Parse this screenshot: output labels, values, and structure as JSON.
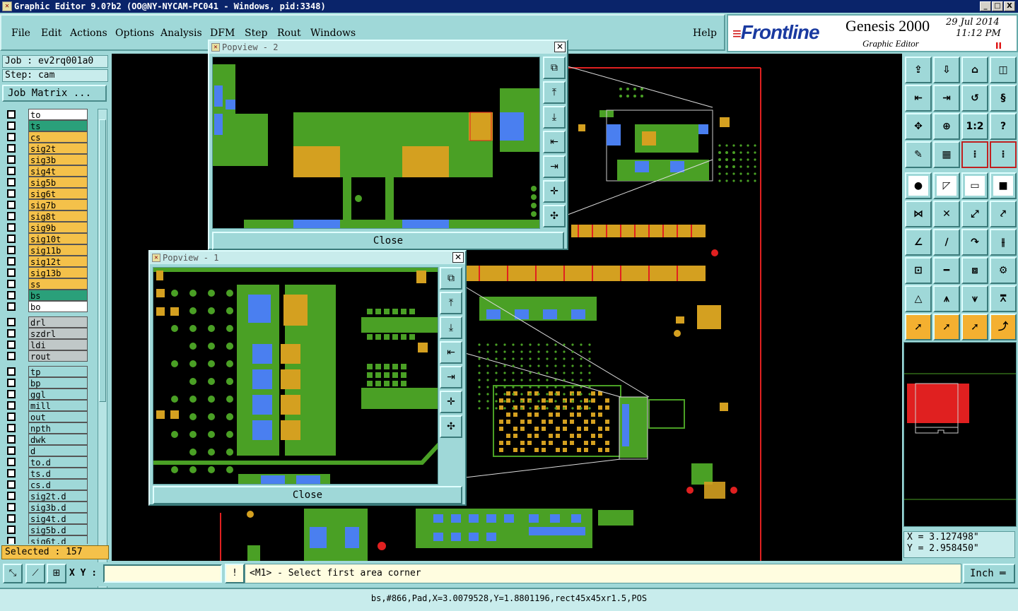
{
  "window": {
    "title": "Graphic Editor 9.0?b2 (OO@NY-NYCAM-PC041 - Windows, pid:3348)",
    "min": "_",
    "max": "□",
    "close": "X"
  },
  "menu": {
    "file": "File",
    "edit": "Edit",
    "actions": "Actions",
    "options": "Options",
    "analysis": "Analysis",
    "dfm": "DFM",
    "step": "Step",
    "rout": "Rout",
    "windows": "Windows",
    "help": "Help"
  },
  "brand": {
    "logo": "Frontline",
    "product": "Genesis 2000",
    "subtitle": "Graphic Editor",
    "date": "29 Jul 2014",
    "time": "11:12 PM",
    "pause": "II"
  },
  "job": {
    "job_line": "Job : ev2rq001a0",
    "step_line": "Step: cam",
    "job_matrix": "Job Matrix ..."
  },
  "layers": {
    "board": [
      {
        "name": "to",
        "color": "#ffffff"
      },
      {
        "name": "ts",
        "color": "#2aa07a"
      },
      {
        "name": "cs",
        "color": "#f4c14a"
      },
      {
        "name": "sig2t",
        "color": "#f4c14a"
      },
      {
        "name": "sig3b",
        "color": "#f4c14a"
      },
      {
        "name": "sig4t",
        "color": "#f4c14a"
      },
      {
        "name": "sig5b",
        "color": "#f4c14a"
      },
      {
        "name": "sig6t",
        "color": "#f4c14a"
      },
      {
        "name": "sig7b",
        "color": "#f4c14a"
      },
      {
        "name": "sig8t",
        "color": "#f4c14a"
      },
      {
        "name": "sig9b",
        "color": "#f4c14a"
      },
      {
        "name": "sig10t",
        "color": "#f4c14a"
      },
      {
        "name": "sig11b",
        "color": "#f4c14a"
      },
      {
        "name": "sig12t",
        "color": "#f4c14a"
      },
      {
        "name": "sig13b",
        "color": "#f4c14a"
      },
      {
        "name": "ss",
        "color": "#f4c14a"
      },
      {
        "name": "bs",
        "color": "#2aa07a"
      },
      {
        "name": "bo",
        "color": "#ffffff"
      }
    ],
    "drill": [
      {
        "name": "drl",
        "color": "#c0c8c8"
      },
      {
        "name": "szdrl",
        "color": "#c0c8c8"
      },
      {
        "name": "ldi",
        "color": "#c0c8c8"
      },
      {
        "name": "rout",
        "color": "#c0c8c8"
      }
    ],
    "misc": [
      {
        "name": "tp",
        "color": "#9fd8d8"
      },
      {
        "name": "bp",
        "color": "#9fd8d8"
      },
      {
        "name": "ggl",
        "color": "#9fd8d8"
      },
      {
        "name": "mill",
        "color": "#9fd8d8"
      },
      {
        "name": "out",
        "color": "#9fd8d8"
      },
      {
        "name": "npth",
        "color": "#9fd8d8"
      },
      {
        "name": "dwk",
        "color": "#9fd8d8"
      },
      {
        "name": "d",
        "color": "#9fd8d8"
      },
      {
        "name": "to.d",
        "color": "#9fd8d8"
      },
      {
        "name": "ts.d",
        "color": "#9fd8d8"
      },
      {
        "name": "cs.d",
        "color": "#9fd8d8"
      },
      {
        "name": "sig2t.d",
        "color": "#9fd8d8"
      },
      {
        "name": "sig3b.d",
        "color": "#9fd8d8"
      },
      {
        "name": "sig4t.d",
        "color": "#9fd8d8"
      },
      {
        "name": "sig5b.d",
        "color": "#9fd8d8"
      },
      {
        "name": "sig6t.d",
        "color": "#9fd8d8"
      }
    ]
  },
  "selected": "Selected : 157",
  "popview2": {
    "title": "Popview - 2",
    "close_label": "Close",
    "x": "✕"
  },
  "popview1": {
    "title": "Popview - 1",
    "close_label": "Close",
    "x": "✕"
  },
  "coords": {
    "x": "X = 3.127498\"",
    "y": "Y = 2.958450\""
  },
  "bottom": {
    "xy_label": "X Y :",
    "xy_value": "",
    "prompt": "<M1> - Select first area corner",
    "unit": "Inch",
    "bang": "!"
  },
  "status": "bs,#866,Pad,X=3.0079528,Y=1.8801196,rect45x45xr1.5,POS",
  "colors": {
    "copper_green": "#4aa025",
    "pad_blue": "#4a7ff0",
    "pad_orange": "#d4a020",
    "feature_red": "#e02020",
    "panel_teal": "#9fd8d8"
  }
}
